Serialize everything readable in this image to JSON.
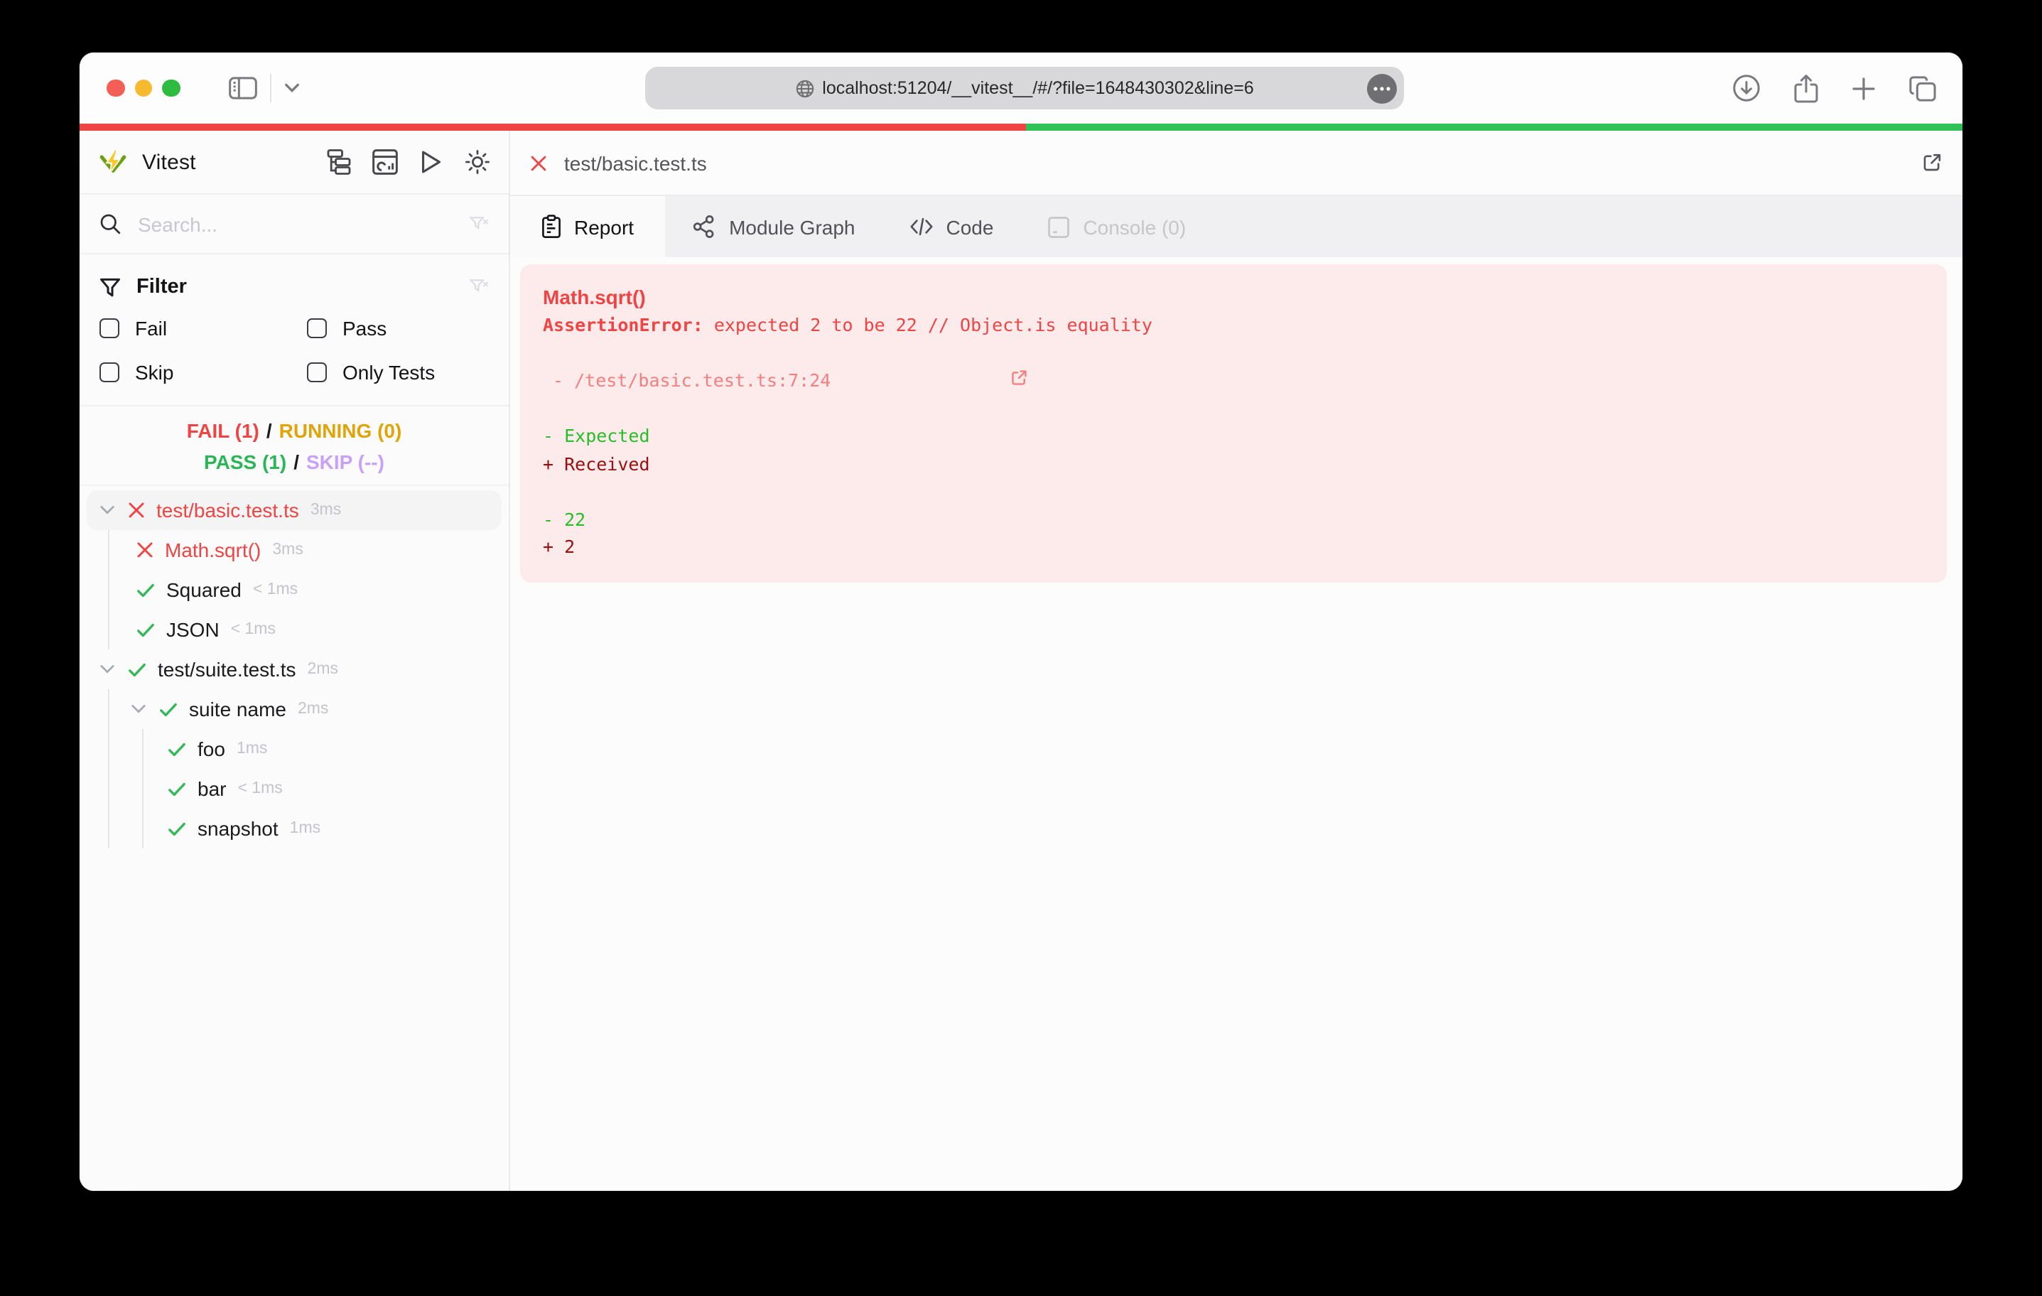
{
  "browser": {
    "url": "localhost:51204/__vitest__/#/?file=1648430302&line=6",
    "traffic_lights": [
      "close",
      "minimize",
      "zoom"
    ],
    "toolbar_icons": [
      "sidebar-toggle",
      "chevron-down",
      "globe",
      "page-more",
      "downloads",
      "share",
      "new-tab",
      "tab-overview"
    ]
  },
  "progress": {
    "fail_percent": 50.3,
    "pass_percent": 49.7,
    "fail_color": "#ef4444",
    "pass_color": "#2fc257"
  },
  "sidebar": {
    "title": "Vitest",
    "header_icons": [
      "tree-view",
      "dashboard",
      "run-all",
      "theme-toggle"
    ],
    "search_placeholder": "Search...",
    "filter": {
      "label": "Filter",
      "options": [
        {
          "label": "Fail",
          "checked": false
        },
        {
          "label": "Pass",
          "checked": false
        },
        {
          "label": "Skip",
          "checked": false
        },
        {
          "label": "Only Tests",
          "checked": false
        }
      ]
    },
    "summary": {
      "fail": "FAIL (1)",
      "running": "RUNNING (0)",
      "pass": "PASS (1)",
      "skip": "SKIP (--)",
      "separator": "/",
      "colors": {
        "fail": "#ef4444",
        "running": "#dfa408",
        "pass": "#2bb656",
        "skip": "#c8a0f5"
      }
    },
    "tree": [
      {
        "label": "test/basic.test.ts",
        "duration": "3ms",
        "status": "fail",
        "level": 0,
        "expanded": true,
        "selected": true
      },
      {
        "label": "Math.sqrt()",
        "duration": "3ms",
        "status": "fail",
        "level": 1
      },
      {
        "label": "Squared",
        "duration": "< 1ms",
        "status": "pass",
        "level": 1
      },
      {
        "label": "JSON",
        "duration": "< 1ms",
        "status": "pass",
        "level": 1
      },
      {
        "label": "test/suite.test.ts",
        "duration": "2ms",
        "status": "pass",
        "level": 0,
        "expanded": true
      },
      {
        "label": "suite name",
        "duration": "2ms",
        "status": "pass",
        "level": 1,
        "expanded": true
      },
      {
        "label": "foo",
        "duration": "1ms",
        "status": "pass",
        "level": 2
      },
      {
        "label": "bar",
        "duration": "< 1ms",
        "status": "pass",
        "level": 2
      },
      {
        "label": "snapshot",
        "duration": "1ms",
        "status": "pass",
        "level": 2
      }
    ]
  },
  "main": {
    "file_tab": {
      "label": "test/basic.test.ts",
      "status": "fail"
    },
    "tabs": [
      {
        "label": "Report",
        "icon": "report-icon",
        "active": true
      },
      {
        "label": "Module Graph",
        "icon": "module-graph-icon",
        "active": false
      },
      {
        "label": "Code",
        "icon": "code-icon",
        "active": false
      },
      {
        "label": "Console (0)",
        "icon": "console-icon",
        "active": false,
        "disabled": true
      }
    ],
    "error": {
      "test_name": "Math.sqrt()",
      "error_name": "AssertionError:",
      "error_message": " expected 2 to be 22 // Object.is equality",
      "stack_location": "- /test/basic.test.ts:7:24",
      "diff": [
        {
          "text": "- Expected",
          "kind": "expected"
        },
        {
          "text": "+ Received",
          "kind": "received"
        },
        {
          "text": "",
          "kind": "blank"
        },
        {
          "text": "- 22",
          "kind": "expected"
        },
        {
          "text": "+ 2",
          "kind": "received"
        }
      ],
      "colors": {
        "error": "#ef4444",
        "stack": "#f37f7f",
        "expected": "#28be28",
        "received": "#9b0e0e",
        "background": "#fdeaea"
      }
    }
  }
}
